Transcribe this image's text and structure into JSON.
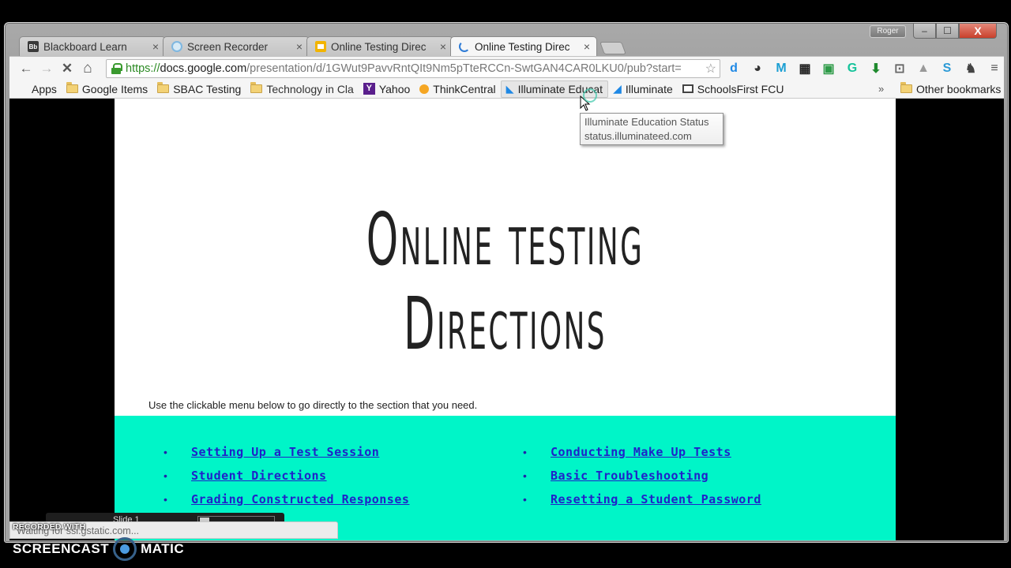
{
  "browser": {
    "tabs": [
      {
        "title": "Blackboard Learn",
        "icon": "blackboard-icon",
        "icon_text": "Bb",
        "active": false
      },
      {
        "title": "Screen Recorder",
        "icon": "screen-recorder-icon",
        "active": false
      },
      {
        "title": "Online Testing Direc",
        "icon": "google-slides-icon",
        "active": false
      },
      {
        "title": "Online Testing Direc",
        "icon": "loading-spinner-icon",
        "active": true
      }
    ],
    "close_glyph": "×",
    "user_name": "Roger",
    "window_controls": {
      "minimize": "–",
      "maximize": "☐",
      "close": "X"
    },
    "nav": {
      "back": "←",
      "forward": "→",
      "stop": "✕",
      "home": "⌂"
    },
    "address": {
      "scheme": "https://",
      "host": "docs.google.com",
      "path": "/presentation/d/1GWut9PavvRntQIt9Nm5pTteRCCn-SwtGAN4CAR0LKU0/pub?start=",
      "star": "☆"
    },
    "extensions": [
      {
        "name": "dictionary-extension-icon",
        "glyph": "d",
        "color": "#1e88e5"
      },
      {
        "name": "speedometer-extension-icon",
        "glyph": "◕",
        "color": "#333333"
      },
      {
        "name": "mote-extension-icon",
        "glyph": "M",
        "color": "#1b9fd3"
      },
      {
        "name": "qr-code-extension-icon",
        "glyph": "▦",
        "color": "#222222"
      },
      {
        "name": "google-classroom-extension-icon",
        "glyph": "▣",
        "color": "#2e9b48"
      },
      {
        "name": "grammarly-extension-icon",
        "glyph": "G",
        "color": "#15c39a"
      },
      {
        "name": "download-extension-icon",
        "glyph": "⬇",
        "color": "#1f8a2e"
      },
      {
        "name": "cast-icon",
        "glyph": "⊡",
        "color": "#666666"
      },
      {
        "name": "google-drive-extension-icon",
        "glyph": "▲",
        "color": "#999999"
      },
      {
        "name": "screencastify-extension-icon",
        "glyph": "S",
        "color": "#2c9ad6"
      },
      {
        "name": "evernote-extension-icon",
        "glyph": "♞",
        "color": "#444444"
      },
      {
        "name": "chrome-menu-icon",
        "glyph": "≡",
        "color": "#555555"
      }
    ],
    "bookmarks": [
      {
        "label": "Apps",
        "icon": "apps-grid-icon"
      },
      {
        "label": "Google Items",
        "icon": "folder-icon"
      },
      {
        "label": "SBAC Testing",
        "icon": "folder-icon"
      },
      {
        "label": "Technology in Cla",
        "icon": "folder-icon"
      },
      {
        "label": "Yahoo",
        "icon": "yahoo-icon",
        "icon_text": "Y"
      },
      {
        "label": "ThinkCentral",
        "icon": "thinkcentral-icon"
      },
      {
        "label": "Illuminate Educat",
        "icon": "illuminate-education-icon",
        "hovered": true
      },
      {
        "label": "Illuminate",
        "icon": "illuminate-icon"
      },
      {
        "label": "SchoolsFirst FCU",
        "icon": "schoolsfirst-icon"
      }
    ],
    "bookmarks_overflow": "»",
    "other_bookmarks": "Other bookmarks",
    "tooltip": {
      "title": "Illuminate Education Status",
      "url": "status.illuminateed.com"
    },
    "status_text": "Waiting for ssl.gstatic.com..."
  },
  "slide": {
    "title": "Online testing Directions",
    "instructions": "Use the clickable menu below to go directly to the section that you need.",
    "menu_color": "#00f5c8",
    "link_color": "#1f22c9",
    "bullet": "•",
    "menu_left": [
      {
        "label": "Setting Up a Test Session"
      },
      {
        "label": "Student Directions"
      },
      {
        "label": "Grading Constructed Responses"
      }
    ],
    "menu_right": [
      {
        "label": "Conducting Make Up Tests"
      },
      {
        "label": "Basic Troubleshooting"
      },
      {
        "label": "Resetting a Student Password"
      }
    ],
    "controls_label": "Slide 1"
  },
  "watermark": {
    "recorded_with": "RECORDED WITH",
    "brand_left": "SCREENCAST",
    "brand_right": "MATIC"
  }
}
